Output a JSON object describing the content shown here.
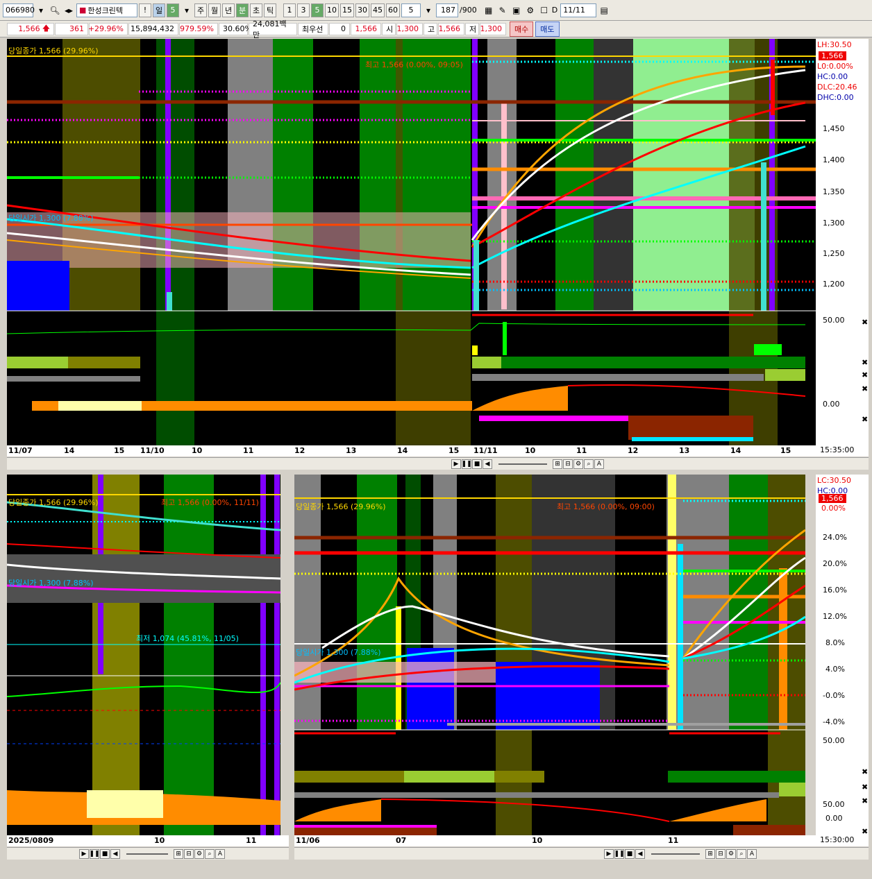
{
  "toolbar": {
    "code": "066980",
    "name": "한성크린텍",
    "period_day": "일",
    "period_n": "5",
    "period_week": "주",
    "period_month": "월",
    "period_year": "년",
    "period_min": "분",
    "period_sec": "초",
    "period_tick": "틱",
    "n1": "1",
    "n3": "3",
    "n5": "5",
    "n10": "10",
    "n15": "15",
    "n30": "30",
    "n45": "45",
    "n60": "60",
    "minute_value": "5",
    "count": "187",
    "count_total": "/900",
    "date": "11/11",
    "d_label": "D"
  },
  "quote": {
    "price": "1,566",
    "change": "361",
    "change_pct": "+29.96%",
    "volume": "15,894,432",
    "vol_ratio": "979.59%",
    "turnover": "30.60%",
    "amount": "24,081백만",
    "priority_label": "최우선",
    "priority_qty": "0",
    "priority_price": "1,566",
    "open_label": "시",
    "open": "1,300",
    "high_label": "고",
    "high": "1,566",
    "low_label": "저",
    "low": "1,300",
    "buy": "매수",
    "sell": "매도"
  },
  "top_chart": {
    "close_label": "당일종가 1,566 (29.96%)",
    "open_label": "당일시가 1,300 (7.88%)",
    "high_label": "최고 1,566 (0.00%, 09:05)",
    "right_labels": [
      "LH:30.50",
      "1,566",
      "L0:0.00%",
      "HC:0.00",
      "DLC:20.46",
      "DHC:0.00"
    ],
    "price_ticks": [
      "1,450",
      "1,400",
      "1,350",
      "1,300",
      "1,250",
      "1,200"
    ],
    "osc_ticks": [
      "50.00",
      "0.00"
    ],
    "dates": [
      "11/07",
      "14",
      "15",
      "11/10",
      "10",
      "11",
      "12",
      "13",
      "14",
      "15",
      "11/11",
      "10",
      "11",
      "12",
      "13",
      "14",
      "15"
    ],
    "time": "15:35:00"
  },
  "bottom_left_chart": {
    "close_label": "당일종가 1,566 (29.96%)",
    "high_label": "최고 1,566 (0.00%, 11/11)",
    "open_label": "당일시가 1,300 (7.88%)",
    "low_label": "최저 1,074 (45.81%, 11/05)",
    "dates": [
      "2025/08",
      "09",
      "10",
      "11"
    ]
  },
  "bottom_right_chart": {
    "close_label": "당일종가 1,566 (29.96%)",
    "high_label": "최고 1,566 (0.00%, 09:00)",
    "open_label": "당일시가 1,300 (7.88%)",
    "right_labels": [
      "LC:30.50",
      "HC:0.00",
      "1,566",
      "0.00%"
    ],
    "pct_ticks": [
      "24.0%",
      "20.0%",
      "16.0%",
      "12.0%",
      "8.0%",
      "4.0%",
      "-0.0%",
      "-4.0%"
    ],
    "osc_ticks": [
      "50.00",
      "50.00",
      "0.00"
    ],
    "dates": [
      "11/06",
      "07",
      "10",
      "11"
    ],
    "time": "15:30:00"
  }
}
